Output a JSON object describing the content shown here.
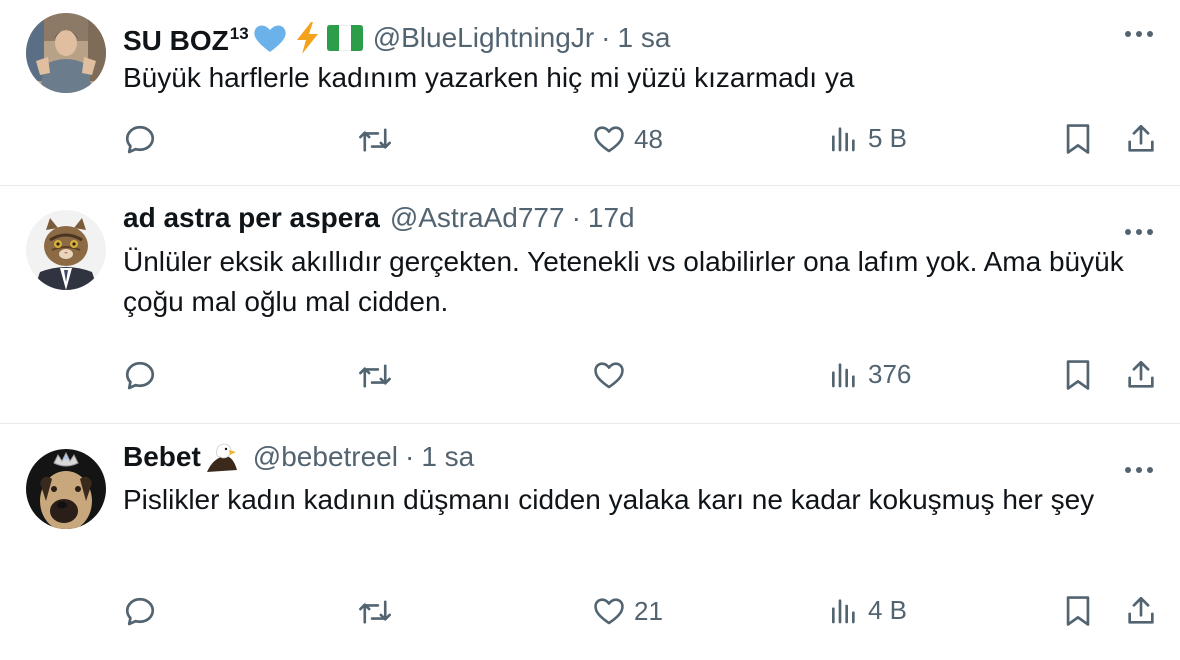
{
  "tweets": [
    {
      "name": "SU BOZ",
      "name_sup": "13",
      "handle": "@BlueLightningJr",
      "separator": "·",
      "time": "1 sa",
      "text": "Büyük harflerle kadınım yazarken hiç mi yüzü kızarmadı ya",
      "likes": "48",
      "views": "5 B",
      "name_emojis": [
        "blue-heart-icon",
        "lightning-icon",
        "flag-nigeria-icon"
      ]
    },
    {
      "name": "ad astra per aspera",
      "handle": "@AstraAd777",
      "separator": "·",
      "time": "17d",
      "text": "Ünlüler eksik akıllıdır gerçekten. Yetenekli vs olabilirler ona lafım yok. Ama büyük çoğu mal oğlu mal cidden.",
      "likes": "",
      "views": "376"
    },
    {
      "name": "Bebet",
      "handle": "@bebetreel",
      "separator": "·",
      "time": "1 sa",
      "text": "Pislikler kadın kadının düşmanı cidden yalaka karı ne kadar kokuşmuş her şey",
      "likes": "21",
      "views": "4 B",
      "name_emojis": [
        "eagle-icon"
      ]
    }
  ],
  "colors": {
    "text": "#0f1419",
    "secondary": "#536471",
    "divider": "#e7e9ea",
    "blue_heart": "#6cb2ea",
    "lightning": "#f4a21e",
    "flag_green": "#2c9d49"
  },
  "action_icons": [
    "reply-icon",
    "retweet-icon",
    "like-icon",
    "views-icon",
    "bookmark-icon",
    "share-icon"
  ]
}
